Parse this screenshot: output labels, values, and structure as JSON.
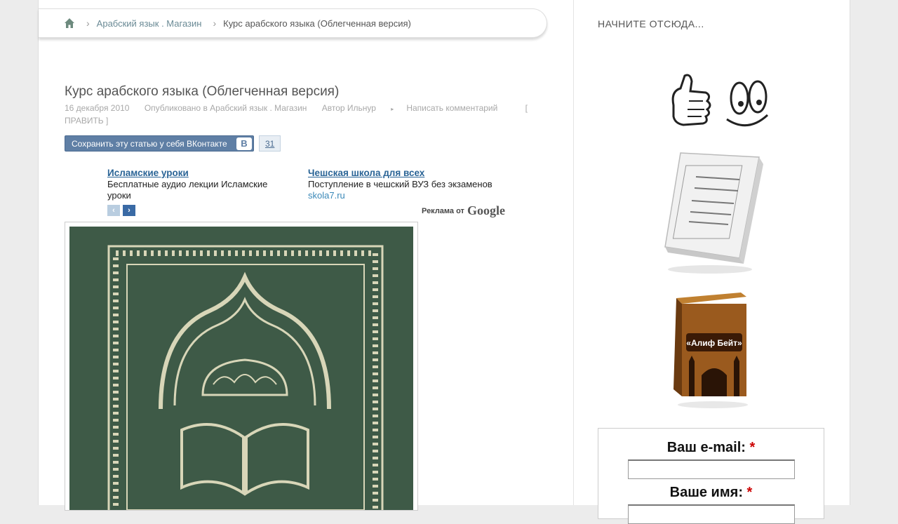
{
  "breadcrumb": {
    "home_icon": "home-icon",
    "items": [
      {
        "label": "Арабский язык . Магазин",
        "link": true
      },
      {
        "label": "Курс арабского языка (Облегченная версия)",
        "link": false
      }
    ]
  },
  "post": {
    "title": "Курс арабского языка (Облегченная версия)",
    "date": "16 декабря 2010",
    "published": "Опубликовано в Арабский язык . Магазин",
    "author": "Автор Ильнур",
    "comment": "Написать комментарий",
    "edit": "[ ПРАВИТЬ ]"
  },
  "vk": {
    "label": "Сохранить эту статью у себя ВКонтакте",
    "logo": "В",
    "count": "31"
  },
  "ads": {
    "items": [
      {
        "title": "Исламские уроки",
        "text": "Бесплатные аудио лекции Исламские уроки",
        "url": ""
      },
      {
        "title": "Чешская школа для всех",
        "text": "Поступление в чешский ВУЗ без экзаменов",
        "url": "skola7.ru"
      }
    ],
    "prev": "‹",
    "next": "›",
    "google_label": "Реклама от",
    "google_brand": "Google"
  },
  "sidebar": {
    "heading": "НАЧНИТЕ ОТСЮДА...",
    "book2_title": "«Алиф Бейт»",
    "form": {
      "email_label": "Ваш e-mail:",
      "name_label": "Ваше имя:",
      "required_mark": "*"
    }
  },
  "colors": {
    "vk": "#5f7fa5",
    "ad_link": "#2a6496",
    "book_green": "#3e5a47",
    "required": "#cc0000"
  }
}
